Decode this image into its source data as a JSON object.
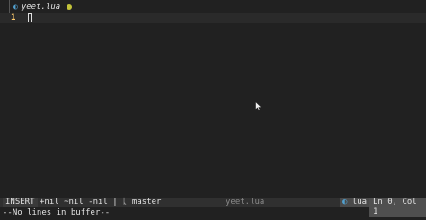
{
  "tab": {
    "icon": "lua-file-icon",
    "filename": "yeet.lua",
    "modified": true
  },
  "editor": {
    "line_number": "1"
  },
  "statusline": {
    "mode": "INSERT",
    "info": "+nil ~nil -nil | ᚳ master",
    "filename": "yeet.lua",
    "filetype_icon": "◐",
    "filetype": "lua",
    "position": "Ln 0, Col 1"
  },
  "message": "--No lines in buffer--",
  "colors": {
    "background": "#212121",
    "line_number": "#ffcb6b",
    "modified_dot": "#c3c33a",
    "lua_icon": "#51a0cf"
  }
}
